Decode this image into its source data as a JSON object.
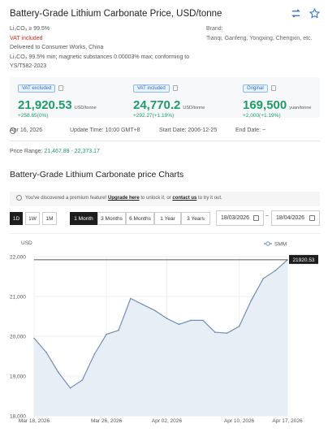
{
  "header": {
    "title": "Battery-Grade Lithium Carbonate Price, USD/tonne",
    "icons": [
      "swap-icon",
      "star-icon"
    ]
  },
  "spec": {
    "purity": "Li₂CO₃ ≥ 99.5%",
    "vat": "VAT included",
    "delivery": "Delivered to Consumer Works, China",
    "standard": "Li₂CO₃ 99.5% min; magnetic substances 0.00003% max; conforming to YS/T582-2023"
  },
  "brand": {
    "label": "Brand:",
    "names": "Tianqi, Ganfeng, Yongxing, Chengxin, etc."
  },
  "prices": [
    {
      "badge": "VAT excluded",
      "value": "21,920.53",
      "unit": "USD/tonne",
      "change": "+258.65(0%)"
    },
    {
      "badge": "VAT included",
      "value": "24,770.2",
      "unit": "USD/tonne",
      "change": "+292.27(+1.19%)"
    },
    {
      "badge": "Original",
      "value": "169,500",
      "unit": "yuan/tonne",
      "change": "+2,000(+1.19%)"
    }
  ],
  "meta": {
    "date": "Apr 16, 2026",
    "update_time": "Update Time: 10:00 GMT+8",
    "start_date": "Start Date: 2006-12-25",
    "end_date": "End Date: ~"
  },
  "price_range": {
    "label": "Price Range: ",
    "value": "21,467.89 - 22,373.17"
  },
  "chart_section": {
    "title": "Battery-Grade Lithium Carbonate price Charts",
    "premium_prefix": "You've discovered a premium feature! ",
    "premium_upgrade": "Upgrade here",
    "premium_mid": " to unlock it, or ",
    "premium_contact": "contact us",
    "premium_suffix": " to try it out."
  },
  "controls": {
    "granularity": [
      "1D",
      "1W",
      "1M"
    ],
    "granularity_active": "1D",
    "periods": [
      "1 Month",
      "3 Months",
      "6 Months",
      "1 Year",
      "3 Years"
    ],
    "period_active": "1 Month",
    "date_from": "18/03/2026",
    "date_to": "18/04/2026",
    "tilde": "~"
  },
  "colors": {
    "accent_green": "#1f9b68",
    "vat_red": "#e2231a",
    "line_blue": "#6f8fb4",
    "area_fill": "#e7eef6"
  },
  "chart_data": {
    "type": "area",
    "ylabel": "USD",
    "legend": "SMM",
    "legend_position": "top-right",
    "ylim": [
      18000,
      22000
    ],
    "yticks": [
      "22,000",
      "21,000",
      "20,000",
      "19,000",
      "18,000"
    ],
    "ytick_values": [
      22000,
      21000,
      20000,
      19000,
      18000
    ],
    "xticks": [
      "Mar 18, 2026",
      "Mar 26, 2026",
      "Apr 02, 2026",
      "Apr 10, 2026",
      "Apr 17, 2026"
    ],
    "xtick_index": [
      0,
      6,
      11,
      17,
      21
    ],
    "x": [
      "Mar 18",
      "Mar 19",
      "Mar 20",
      "Mar 23",
      "Mar 24",
      "Mar 25",
      "Mar 26",
      "Mar 27",
      "Mar 30",
      "Mar 31",
      "Apr 01",
      "Apr 02",
      "Apr 03",
      "Apr 07",
      "Apr 08",
      "Apr 09",
      "Apr 10",
      "Apr 13",
      "Apr 14",
      "Apr 15",
      "Apr 16",
      "Apr 17"
    ],
    "series": [
      {
        "name": "SMM",
        "values": [
          19950,
          19600,
          19100,
          18700,
          18900,
          19550,
          20050,
          20150,
          20950,
          20800,
          20650,
          20450,
          20300,
          20400,
          20400,
          20100,
          20080,
          20250,
          20900,
          21450,
          21650,
          21920.53
        ]
      }
    ],
    "last_label": "21920.53",
    "grid": true
  }
}
